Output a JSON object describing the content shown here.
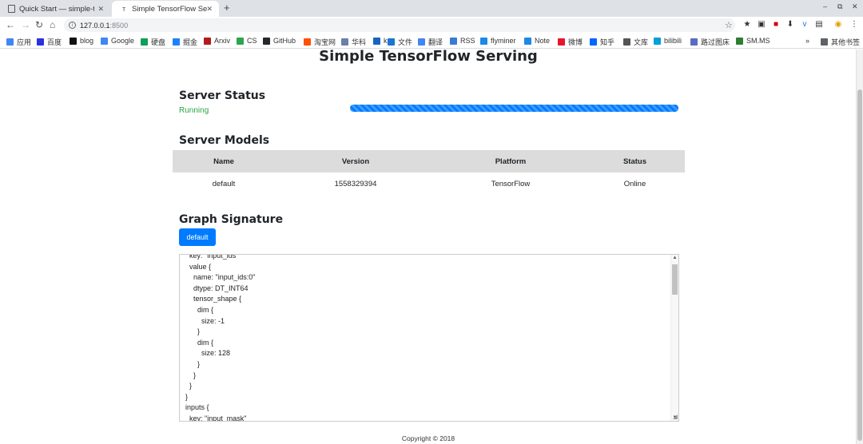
{
  "browser": {
    "tabs": [
      {
        "title": "Quick Start — simple-tensorflow-serving",
        "active": false
      },
      {
        "title": "Simple TensorFlow Serving",
        "active": true
      }
    ],
    "new_tab": "+",
    "url_host": "127.0.0.1",
    "url_port": ":8500",
    "bookmarks": [
      {
        "label": "应用",
        "icon": "apps-icon",
        "color": "#4285f4"
      },
      {
        "label": "百度",
        "icon": "baidu-icon",
        "color": "#2932e1"
      },
      {
        "label": "blog",
        "icon": "blog-icon",
        "color": "#111111"
      },
      {
        "label": "Google",
        "icon": "google-icon",
        "color": "#4285f4"
      },
      {
        "label": "硬盘",
        "icon": "drive-icon",
        "color": "#0f9d58"
      },
      {
        "label": "掘金",
        "icon": "juejin-icon",
        "color": "#1e80ff"
      },
      {
        "label": "Arxiv",
        "icon": "arxiv-icon",
        "color": "#b31b1b"
      },
      {
        "label": "CS",
        "icon": "cs-icon",
        "color": "#2ea44f"
      },
      {
        "label": "GitHub",
        "icon": "github-icon",
        "color": "#24292e"
      },
      {
        "label": "淘宝网",
        "icon": "taobao-icon",
        "color": "#ff5000"
      },
      {
        "label": "华科",
        "icon": "hust-icon",
        "color": "#6b7fa8"
      },
      {
        "label": "k",
        "icon": "k-icon",
        "color": "#1565c0"
      },
      {
        "label": "文件",
        "icon": "file-icon",
        "color": "#1976d2"
      },
      {
        "label": "翻译",
        "icon": "translate-icon",
        "color": "#4285f4"
      },
      {
        "label": "RSS",
        "icon": "rss-icon",
        "color": "#3a7bd5"
      },
      {
        "label": "flyminer",
        "icon": "flyminer-icon",
        "color": "#1e88e5"
      },
      {
        "label": "Note",
        "icon": "note-icon",
        "color": "#1e88e5"
      },
      {
        "label": "微博",
        "icon": "weibo-icon",
        "color": "#e6162d"
      },
      {
        "label": "知乎",
        "icon": "zhihu-icon",
        "color": "#0066ff"
      },
      {
        "label": "文库",
        "icon": "wenku-icon",
        "color": "#555555"
      },
      {
        "label": "bilibili",
        "icon": "bilibili-icon",
        "color": "#00a1d6"
      },
      {
        "label": "路过图床",
        "icon": "imgbed-icon",
        "color": "#5c6bc0"
      },
      {
        "label": "SM.MS",
        "icon": "smms-icon",
        "color": "#2e7d32"
      }
    ],
    "more_bookmarks": "»",
    "other_bookmarks": "其他书签"
  },
  "page": {
    "title": "Simple TensorFlow Serving",
    "server_status": {
      "heading": "Server Status",
      "status": "Running",
      "progress": 1.0
    },
    "server_models": {
      "heading": "Server Models",
      "columns": [
        "Name",
        "Version",
        "Platform",
        "Status"
      ],
      "rows": [
        [
          "default",
          "1558329394",
          "TensorFlow",
          "Online"
        ]
      ]
    },
    "graph_signature": {
      "heading": "Graph Signature",
      "button_label": "default",
      "lines": [
        "  key: \"input_ids\"",
        "  value {",
        "    name: \"input_ids:0\"",
        "    dtype: DT_INT64",
        "    tensor_shape {",
        "      dim {",
        "        size: -1",
        "      }",
        "      dim {",
        "        size: 128",
        "      }",
        "    }",
        "  }",
        "}",
        "inputs {",
        "  key: \"input_mask\""
      ]
    },
    "footer": "Copyright © 2018"
  }
}
